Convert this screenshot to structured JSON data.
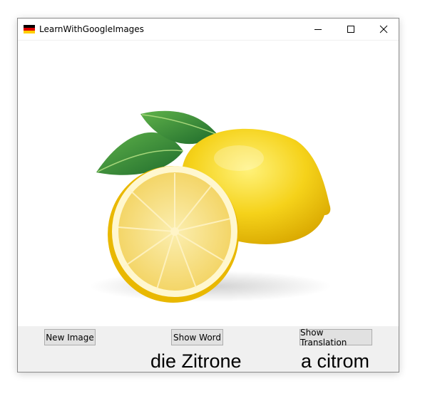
{
  "window": {
    "title": "LearnWithGoogleImages",
    "flag_colors": [
      "#000000",
      "#dd0000",
      "#ffce00"
    ],
    "controls": [
      "minimize-icon",
      "maximize-icon",
      "close-icon"
    ]
  },
  "image": {
    "subject": "lemon",
    "colors": {
      "peel": "#f6d21a",
      "flesh": "#f8e27a",
      "leaf": "#2e8b3a"
    }
  },
  "buttons": {
    "new_image": "New Image",
    "show_word": "Show Word",
    "show_translation": "Show Translation"
  },
  "labels": {
    "word": "die Zitrone",
    "translation": "a citrom"
  }
}
